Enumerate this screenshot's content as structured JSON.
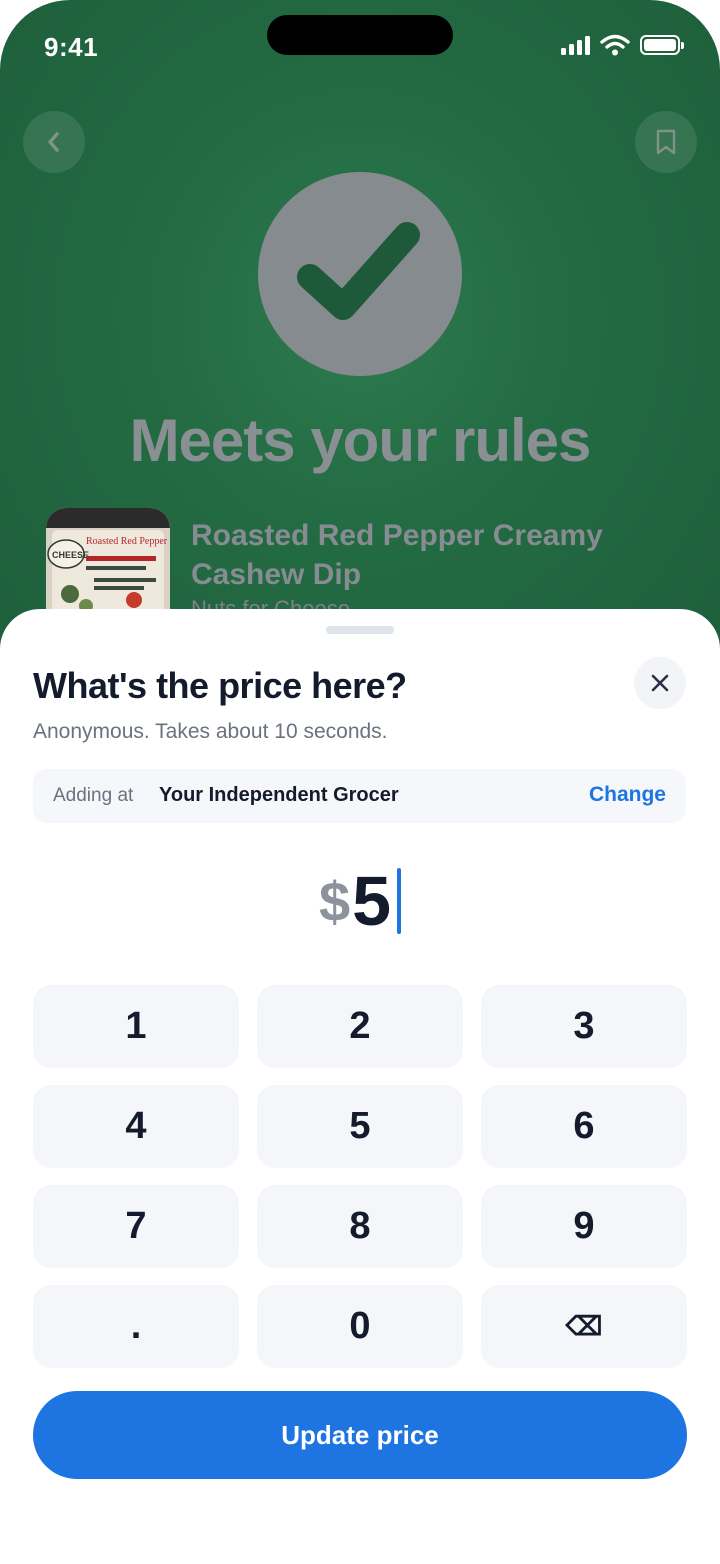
{
  "status_bar": {
    "time": "9:41"
  },
  "result": {
    "verdict": "Meets your rules",
    "product_name": "Roasted Red Pepper Creamy Cashew Dip",
    "product_brand": "Nuts for Cheese",
    "thumbnail_label": "Roasted Red Pepper"
  },
  "sheet": {
    "title": "What's the price here?",
    "subtitle": "Anonymous. Takes about 10 seconds.",
    "store_label": "Adding at",
    "store_name": "Your Independent Grocer",
    "change_label": "Change",
    "currency_symbol": "$",
    "price_value": "5",
    "keypad": {
      "keys": [
        "1",
        "2",
        "3",
        "4",
        "5",
        "6",
        "7",
        "8",
        "9",
        ".",
        "0",
        "⌫"
      ]
    },
    "submit_label": "Update price"
  },
  "colors": {
    "accent": "#1e74e0",
    "background_green": "#236b43",
    "text_dark": "#141b2d"
  }
}
